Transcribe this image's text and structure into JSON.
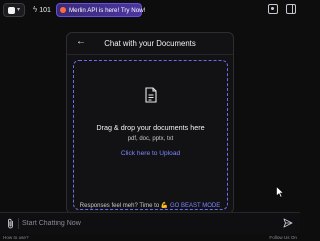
{
  "topbar": {
    "credits": "101",
    "promo": "Merlin API is here! Try Now!",
    "icons": [
      "logo-icon",
      "chevron-down-icon",
      "bolt-icon",
      "image-icon",
      "panel-icon"
    ]
  },
  "card": {
    "title": "Chat with your Documents",
    "back_icon": "arrow-left-icon"
  },
  "dropzone": {
    "title": "Drag & drop your documents here",
    "types": "pdf, doc, pptx, txt",
    "upload_link": "Click here to Upload",
    "icon": "document-icon"
  },
  "feedback": {
    "text": "Responses feel meh? Time to",
    "emoji": "💪",
    "link": "GO BEAST MODE"
  },
  "composer": {
    "placeholder": "Start Chatting Now",
    "icons": [
      "paperclip-icon",
      "send-icon"
    ]
  },
  "footer": {
    "help": "How to use?",
    "follow": "Follow Us On"
  },
  "colors": {
    "background": "#0d0d0e",
    "accent": "#6b6cf0",
    "link": "#7f86ff",
    "promo": "#4b35a0"
  }
}
